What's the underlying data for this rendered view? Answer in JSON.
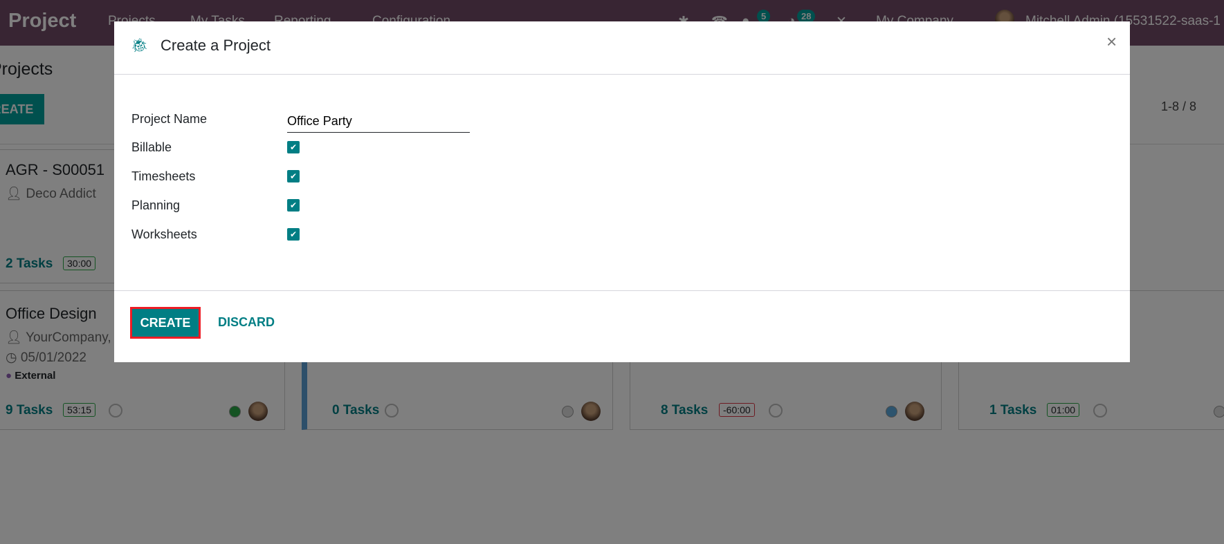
{
  "navbar": {
    "brand": "Project",
    "menu": [
      "Projects",
      "My Tasks",
      "Reporting",
      "Configuration"
    ],
    "messages_count": "5",
    "activities_count": "28",
    "company": "My Company",
    "user": "Mitchell Admin (15531522-saas-1"
  },
  "page": {
    "breadcrumb": "Projects",
    "create_label": "CREATE",
    "pager": "1-8 / 8"
  },
  "cards": [
    {
      "title": "AGR - S00051",
      "customer": "Deco Addict",
      "tasks": "2 Tasks",
      "time": "30:00"
    },
    {
      "title": "Office Design",
      "customer": "YourCompany, J",
      "date": "05/01/2022",
      "tag": "External",
      "tasks": "9 Tasks",
      "time": "53:15",
      "status": "green"
    },
    {
      "tasks": "0 Tasks",
      "status": "grey"
    },
    {
      "tasks": "8 Tasks",
      "time": "-60:00",
      "status": "blue"
    },
    {
      "tasks": "1 Tasks",
      "time": "01:00",
      "status": "grey"
    }
  ],
  "modal": {
    "title": "Create a Project",
    "close": "×",
    "fields": {
      "project_name_label": "Project Name",
      "project_name_value": "Office Party",
      "billable": "Billable",
      "timesheets": "Timesheets",
      "planning": "Planning",
      "worksheets": "Worksheets"
    },
    "create_label": "CREATE",
    "discard_label": "DISCARD"
  },
  "colors": {
    "brand": "#714B67",
    "accent": "#017e84",
    "highlight": "#ee1c25"
  }
}
